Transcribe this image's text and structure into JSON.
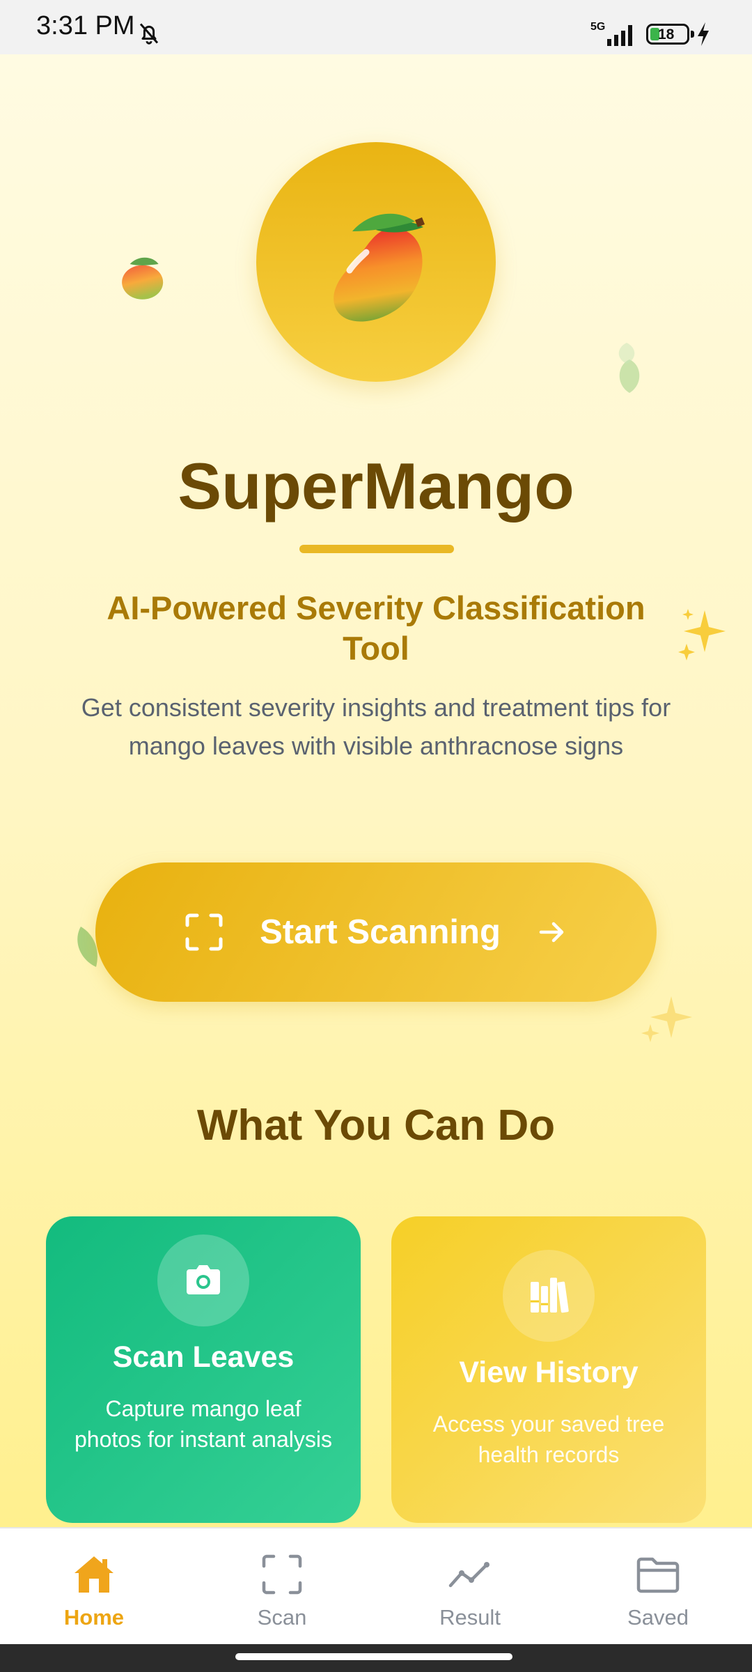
{
  "status_bar": {
    "time": "3:31 PM",
    "network": "5G",
    "battery_level": "18"
  },
  "app": {
    "title": "SuperMango",
    "subtitle": "AI-Powered Severity Classification Tool",
    "description": "Get consistent severity insights and treatment tips for mango leaves with visible anthracnose signs",
    "cta_label": "Start Scanning"
  },
  "features": {
    "section_title": "What You Can Do",
    "cards": [
      {
        "title": "Scan Leaves",
        "description": "Capture mango leaf photos for instant analysis",
        "icon": "camera-icon",
        "color": "#13bb7e"
      },
      {
        "title": "View History",
        "description": "Access your saved tree health records",
        "icon": "books-icon",
        "color": "#f6cf27"
      }
    ]
  },
  "bottom_nav": {
    "items": [
      {
        "label": "Home",
        "icon": "home-icon",
        "active": true
      },
      {
        "label": "Scan",
        "icon": "scan-frame-icon",
        "active": false
      },
      {
        "label": "Result",
        "icon": "line-chart-icon",
        "active": false
      },
      {
        "label": "Saved",
        "icon": "folder-icon",
        "active": false
      }
    ]
  },
  "colors": {
    "primary": "#e9b413",
    "title_brown": "#6b4a05",
    "subtitle_gold": "#a97a07",
    "nav_active": "#eda512",
    "nav_inactive": "#8a9099"
  }
}
